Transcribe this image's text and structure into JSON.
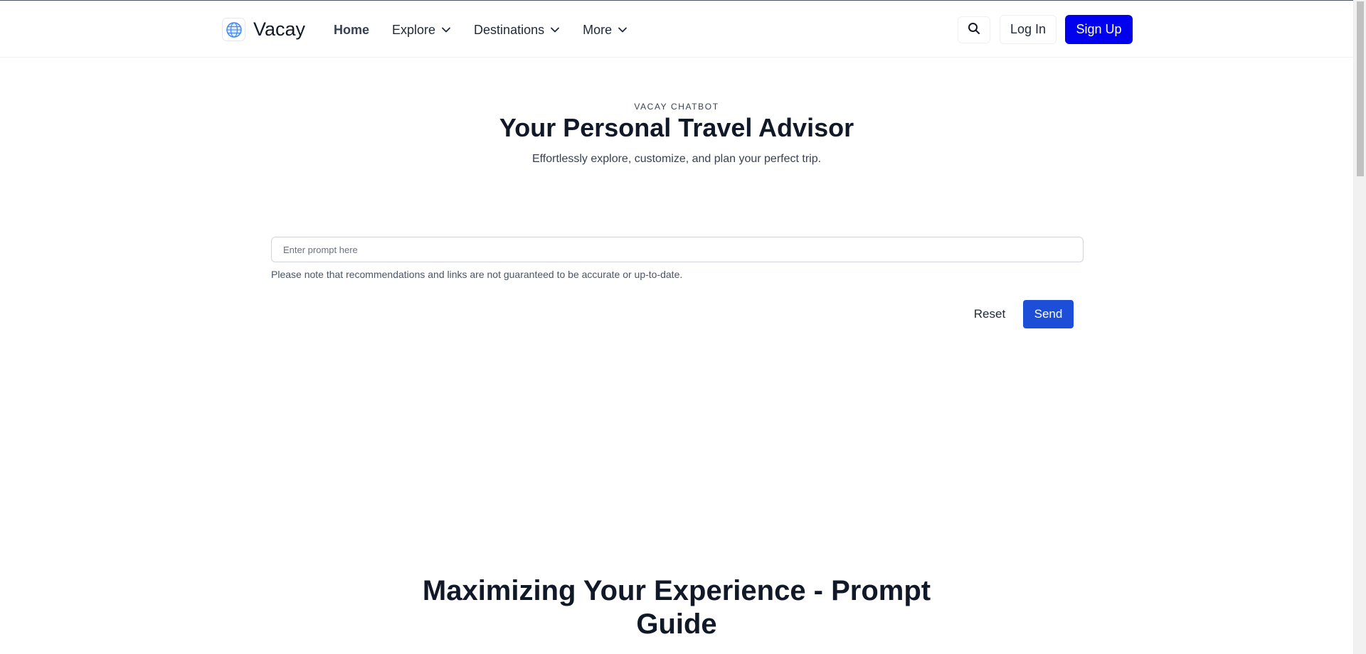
{
  "header": {
    "brand": "Vacay",
    "nav": [
      {
        "label": "Home",
        "active": true,
        "has_dropdown": false
      },
      {
        "label": "Explore",
        "active": false,
        "has_dropdown": true
      },
      {
        "label": "Destinations",
        "active": false,
        "has_dropdown": true
      },
      {
        "label": "More",
        "active": false,
        "has_dropdown": true
      }
    ],
    "login_label": "Log In",
    "signup_label": "Sign Up",
    "signup_color": "#0000ee"
  },
  "hero": {
    "eyebrow": "VACAY CHATBOT",
    "title": "Your Personal Travel Advisor",
    "subtitle": "Effortlessly explore, customize, and plan your perfect trip."
  },
  "chat": {
    "prompt_value": "",
    "prompt_placeholder": "Enter prompt here",
    "disclaimer": "Please note that recommendations and links are not guaranteed to be accurate or up-to-date.",
    "reset_label": "Reset",
    "send_label": "Send",
    "send_color": "#1d4ed8"
  },
  "guide": {
    "title": "Maximizing Your Experience - Prompt Guide"
  },
  "icons": {
    "logo": "globe-logo-icon",
    "search": "search-icon",
    "dropdown": "chevron-down-icon"
  }
}
